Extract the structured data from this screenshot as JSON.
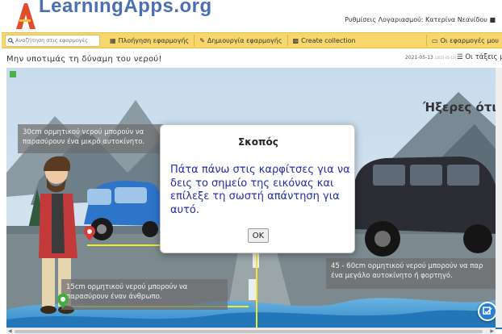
{
  "header": {
    "logo_text": "LearningApps.org",
    "account_text": "Ρυθμίσεις Λογαριασμού: Κατερίνα Νεανίδου"
  },
  "navbar": {
    "search_placeholder": "Αναζήτηση στις εφαρμογές",
    "items": [
      {
        "label": "Πλοήγηση εφαρμογής",
        "icon": "grid-icon"
      },
      {
        "label": "Δημιουργία εφαρμογής",
        "icon": "pencil-icon"
      },
      {
        "label": "Create collection",
        "icon": "collection-icon"
      },
      {
        "label": "Οι εφαρμογές μου",
        "icon": "apps-icon"
      }
    ]
  },
  "subheader": {
    "app_title": "Μην υποτιμάς τη δύναμη του νερού!",
    "date": "2021-05-13",
    "date_small": "(2021-05-13)",
    "classes_label": "Οι τάξεις μ"
  },
  "stage": {
    "did_you_know": "Ήξερες ότι...",
    "captions": {
      "top": "30cm ορμητικού νερού μπορούν να παρασύρουν ένα μικρό αυτοκίνητο.",
      "bottom": "15cm ορμητικού νερού μπορούν να παρασύρουν έναν άνθρωπο.",
      "right": "45 - 60cm ορμητικού νερού μπορούν να παρ ένα μεγάλο αυτοκίνητο ή φορτηγό."
    }
  },
  "dialog": {
    "title": "Σκοπός",
    "body": "Πάτα πάνω στις καρφίτσες για να δεις το σημείο της εικόνας και επίλεξε τη σωστή απάντηση για αυτό.",
    "ok_label": "OK"
  },
  "colors": {
    "navbar_bg": "#f7d66b",
    "logo_blue": "#4a6fb3",
    "dialog_text": "#1f2fa8",
    "pin_red": "#d93a3a",
    "pin_green": "#3fae3f",
    "line_yellow": "#f3e82c"
  }
}
